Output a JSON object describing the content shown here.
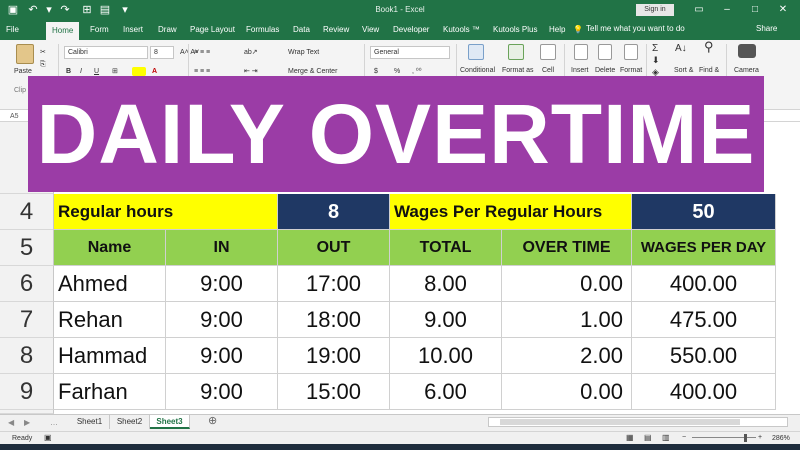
{
  "window": {
    "title": "Book1 - Excel",
    "signin": "Sign in",
    "tell_me": "Tell me what you want to do",
    "share": "Share"
  },
  "tabs": [
    "File",
    "Home",
    "Form",
    "Insert",
    "Draw",
    "Page Layout",
    "Formulas",
    "Data",
    "Review",
    "View",
    "Developer",
    "Kutools ™",
    "Kutools Plus",
    "Help"
  ],
  "ribbon": {
    "paste": "Paste",
    "font_name": "Calibri",
    "font_size": "8",
    "wrap_text": "Wrap Text",
    "merge_center": "Merge & Center",
    "number_format": "General",
    "currency_symbol": "$",
    "percent_symbol": "%",
    "conditional": "Conditional",
    "format_as": "Format as",
    "cell": "Cell",
    "insert": "Insert",
    "delete": "Delete",
    "format": "Format",
    "sort": "Sort &",
    "find": "Find &",
    "camera": "Camera",
    "clipboard_partial": "Clip",
    "name_box_partial": "A5"
  },
  "banner": {
    "text": "DAILY OVERTIME"
  },
  "sheet": {
    "row4": {
      "num": "4",
      "label": "Regular hours",
      "hours": "8",
      "wage_label": "Wages Per Regular Hours",
      "wage": "50"
    },
    "row5": {
      "num": "5",
      "headers": [
        "Name",
        "IN",
        "OUT",
        "TOTAL",
        "OVER TIME",
        "WAGES PER DAY"
      ]
    },
    "rows": [
      {
        "num": "6",
        "name": "Ahmed",
        "in": "9:00",
        "out": "17:00",
        "total": "8.00",
        "ot": "0.00",
        "wages": "400.00"
      },
      {
        "num": "7",
        "name": "Rehan",
        "in": "9:00",
        "out": "18:00",
        "total": "9.00",
        "ot": "1.00",
        "wages": "475.00"
      },
      {
        "num": "8",
        "name": "Hammad",
        "in": "9:00",
        "out": "19:00",
        "total": "10.00",
        "ot": "2.00",
        "wages": "550.00"
      },
      {
        "num": "9",
        "name": "Farhan",
        "in": "9:00",
        "out": "15:00",
        "total": "6.00",
        "ot": "0.00",
        "wages": "400.00"
      }
    ]
  },
  "sheet_tabs": [
    "Sheet1",
    "Sheet2",
    "Sheet3"
  ],
  "add_sheet": "⊕",
  "status": {
    "ready": "Ready",
    "zoom": "286%"
  },
  "colors": {
    "excel_green": "#217346",
    "banner": "#9b3ca6",
    "yellow": "#ffff00",
    "navy": "#1f3864",
    "green_header": "#92d050"
  }
}
